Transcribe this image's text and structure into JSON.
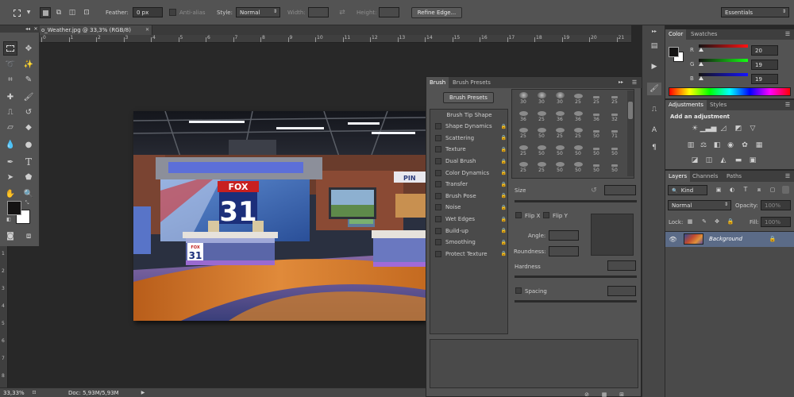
{
  "options_bar": {
    "feather_label": "Feather:",
    "feather_value": "0 px",
    "antialias_label": "Anti-alias",
    "style_label": "Style:",
    "style_value": "Normal",
    "width_label": "Width:",
    "height_label": "Height:",
    "refine_edge_label": "Refine Edge...",
    "workspace_value": "Essentials"
  },
  "document": {
    "tab_title": "o_Weather.jpg @ 33,3% (RGB/8)",
    "zoom": "33,33%",
    "doc_info": "Doc: 5,93M/5,93M",
    "ruler_ticks": [
      "0",
      "1",
      "2",
      "3",
      "4",
      "5",
      "6",
      "7",
      "8",
      "9",
      "10",
      "11",
      "12",
      "13",
      "14",
      "15",
      "16",
      "17",
      "18",
      "19",
      "20",
      "21"
    ],
    "ruler_vticks": [
      "1",
      "2",
      "3",
      "4",
      "5",
      "6",
      "7",
      "8"
    ]
  },
  "image": {
    "logo_word": "FOX",
    "logo_number": "31",
    "desk_logo_word": "FOX",
    "desk_logo_number": "31",
    "right_panel_text": "PIN"
  },
  "brush_panel": {
    "tab_brush": "Brush",
    "tab_presets": "Brush Presets",
    "presets_button": "Brush Presets",
    "tip_shape_header": "Brush Tip Shape",
    "options": [
      "Shape Dynamics",
      "Scattering",
      "Texture",
      "Dual Brush",
      "Color Dynamics",
      "Transfer",
      "Brush Pose",
      "Noise",
      "Wet Edges",
      "Build-up",
      "Smoothing",
      "Protect Texture"
    ],
    "tip_rows": [
      [
        "30",
        "30",
        "30",
        "25",
        "25",
        "25"
      ],
      [
        "36",
        "25",
        "36",
        "36",
        "36",
        "32"
      ],
      [
        "25",
        "50",
        "25",
        "25",
        "50",
        "71"
      ],
      [
        "25",
        "50",
        "50",
        "50",
        "50",
        "50"
      ],
      [
        "25",
        "25",
        "50",
        "50",
        "50",
        "50"
      ]
    ],
    "size_label": "Size",
    "flip_x": "Flip X",
    "flip_y": "Flip Y",
    "angle_label": "Angle:",
    "roundness_label": "Roundness:",
    "hardness_label": "Hardness",
    "spacing_label": "Spacing"
  },
  "color_panel": {
    "tab_color": "Color",
    "tab_swatches": "Swatches",
    "r_label": "R",
    "g_label": "G",
    "b_label": "B",
    "r_value": "20",
    "g_value": "19",
    "b_value": "19"
  },
  "adjustments_panel": {
    "tab_adjustments": "Adjustments",
    "tab_styles": "Styles",
    "heading": "Add an adjustment"
  },
  "layers_panel": {
    "tab_layers": "Layers",
    "tab_channels": "Channels",
    "tab_paths": "Paths",
    "kind_value": "Kind",
    "blend_value": "Normal",
    "opacity_label": "Opacity:",
    "opacity_value": "100%",
    "lock_label": "Lock:",
    "fill_label": "Fill:",
    "fill_value": "100%",
    "layer_name": "Background"
  },
  "colors": {
    "ui_dark": "#282828",
    "panel": "#535353",
    "selection": "#5b6b87"
  }
}
